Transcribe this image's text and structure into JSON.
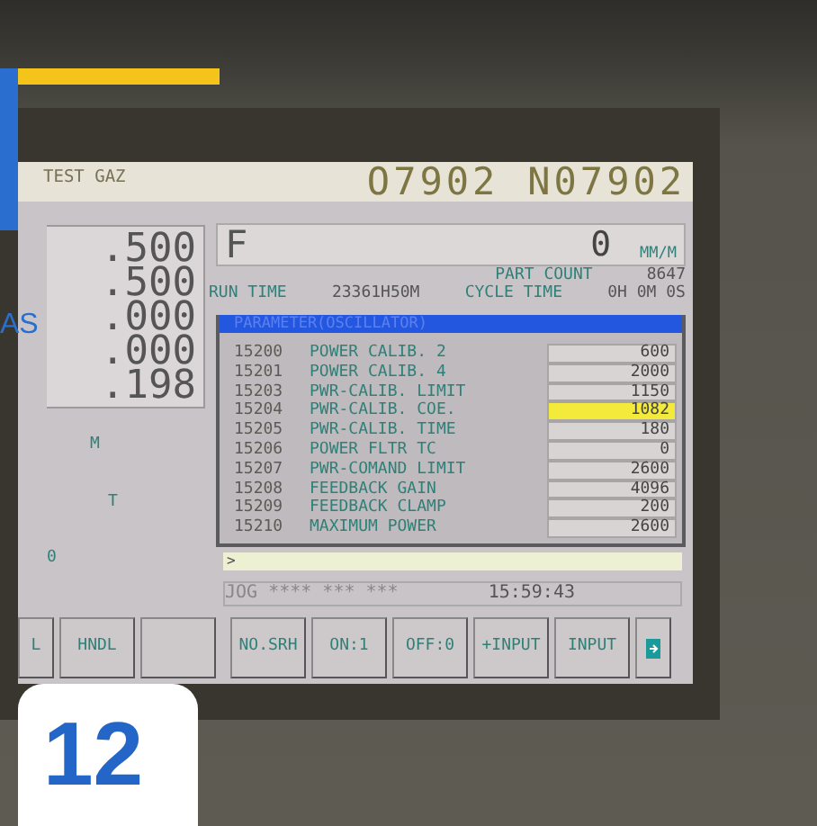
{
  "header": {
    "title": "TEST GAZ",
    "program": "O7902",
    "sequence": "N07902"
  },
  "side_text": "AS",
  "positions": [
    ".500",
    ".500",
    ".000",
    ".000",
    ".198"
  ],
  "left_labels": [
    "M",
    "T",
    "0"
  ],
  "feed": {
    "label": "F",
    "value": "0",
    "unit": "MM/M"
  },
  "part_count": {
    "label": "PART COUNT",
    "value": "8647"
  },
  "run_time": {
    "label": "RUN TIME",
    "value": "23361H50M"
  },
  "cycle_time": {
    "label": "CYCLE TIME",
    "value": "0H 0M 0S"
  },
  "parameter_window": {
    "title": "PARAMETER(OSCILLATOR)",
    "rows": [
      {
        "number": "15200",
        "name": "POWER CALIB. 2",
        "value": "600",
        "selected": false
      },
      {
        "number": "15201",
        "name": "POWER CALIB. 4",
        "value": "2000",
        "selected": false
      },
      {
        "number": "15203",
        "name": "PWR-CALIB. LIMIT",
        "value": "1150",
        "selected": false
      },
      {
        "number": "15204",
        "name": "PWR-CALIB. COE.",
        "value": "1082",
        "selected": true
      },
      {
        "number": "15205",
        "name": "PWR-CALIB. TIME",
        "value": "180",
        "selected": false
      },
      {
        "number": "15206",
        "name": "POWER FLTR TC",
        "value": "0",
        "selected": false
      },
      {
        "number": "15207",
        "name": "PWR-COMAND LIMIT",
        "value": "2600",
        "selected": false
      },
      {
        "number": "15208",
        "name": "FEEDBACK GAIN",
        "value": "4096",
        "selected": false
      },
      {
        "number": "15209",
        "name": "FEEDBACK CLAMP",
        "value": "200",
        "selected": false
      },
      {
        "number": "15210",
        "name": "MAXIMUM POWER",
        "value": "2600",
        "selected": false
      }
    ]
  },
  "input_line": ">",
  "status_bar": {
    "mode": "JOG **** *** ***",
    "time": "15:59:43"
  },
  "softkeys": [
    {
      "kind": "text",
      "label": "L"
    },
    {
      "kind": "text",
      "label": "HNDL"
    },
    {
      "kind": "blank"
    },
    {
      "kind": "text",
      "label": "NO.SRH"
    },
    {
      "kind": "text",
      "label": "ON:1"
    },
    {
      "kind": "text",
      "label": "OFF:0"
    },
    {
      "kind": "text",
      "label": "+INPUT"
    },
    {
      "kind": "text",
      "label": "INPUT"
    },
    {
      "kind": "next"
    }
  ],
  "badge": "12"
}
